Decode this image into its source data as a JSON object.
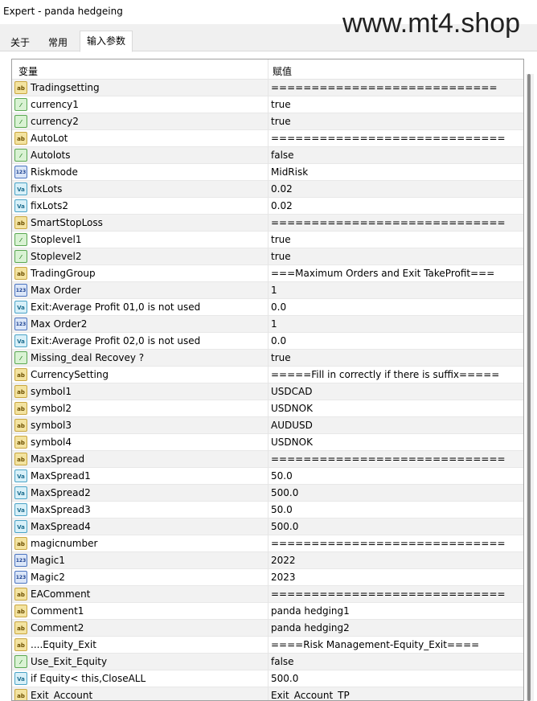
{
  "window": {
    "title": "Expert - panda hedgeing"
  },
  "watermark": "www.mt4.shop",
  "tabs": [
    {
      "label": "关于"
    },
    {
      "label": "常用"
    },
    {
      "label": "输入参数"
    }
  ],
  "grid": {
    "col_variable": "变量",
    "col_value": "赋值",
    "rows": [
      {
        "icon": "ab",
        "name": "Tradingsetting",
        "value": "============================"
      },
      {
        "icon": "bool",
        "name": "currency1",
        "value": "true"
      },
      {
        "icon": "bool",
        "name": "currency2",
        "value": "true"
      },
      {
        "icon": "ab",
        "name": "AutoLot",
        "value": "============================="
      },
      {
        "icon": "bool",
        "name": "Autolots",
        "value": "false"
      },
      {
        "icon": "int",
        "name": "Riskmode",
        "value": "MidRisk"
      },
      {
        "icon": "dbl",
        "name": "fixLots",
        "value": "0.02"
      },
      {
        "icon": "dbl",
        "name": "fixLots2",
        "value": "0.02"
      },
      {
        "icon": "ab",
        "name": "SmartStopLoss",
        "value": "============================="
      },
      {
        "icon": "bool",
        "name": "Stoplevel1",
        "value": "true"
      },
      {
        "icon": "bool",
        "name": "Stoplevel2",
        "value": "true"
      },
      {
        "icon": "ab",
        "name": "TradingGroup",
        "value": "===Maximum Orders and Exit TakeProfit==="
      },
      {
        "icon": "int",
        "name": "Max Order",
        "value": "1"
      },
      {
        "icon": "dbl",
        "name": "Exit:Average Profit 01,0 is not used",
        "value": "0.0"
      },
      {
        "icon": "int",
        "name": "Max Order2",
        "value": "1"
      },
      {
        "icon": "dbl",
        "name": "Exit:Average Profit 02,0 is not used",
        "value": "0.0"
      },
      {
        "icon": "bool",
        "name": "Missing_deal Recovey ?",
        "value": "true"
      },
      {
        "icon": "ab",
        "name": "CurrencySetting",
        "value": "=====Fill in correctly if there is suffix====="
      },
      {
        "icon": "ab",
        "name": "symbol1",
        "value": "USDCAD"
      },
      {
        "icon": "ab",
        "name": "symbol2",
        "value": "USDNOK"
      },
      {
        "icon": "ab",
        "name": "symbol3",
        "value": "AUDUSD"
      },
      {
        "icon": "ab",
        "name": "symbol4",
        "value": "USDNOK"
      },
      {
        "icon": "ab",
        "name": "MaxSpread",
        "value": "============================="
      },
      {
        "icon": "dbl",
        "name": "MaxSpread1",
        "value": "50.0"
      },
      {
        "icon": "dbl",
        "name": "MaxSpread2",
        "value": "500.0"
      },
      {
        "icon": "dbl",
        "name": "MaxSpread3",
        "value": "50.0"
      },
      {
        "icon": "dbl",
        "name": "MaxSpread4",
        "value": "500.0"
      },
      {
        "icon": "ab",
        "name": "magicnumber",
        "value": "============================="
      },
      {
        "icon": "int",
        "name": "Magic1",
        "value": "2022"
      },
      {
        "icon": "int",
        "name": "Magic2",
        "value": "2023"
      },
      {
        "icon": "ab",
        "name": "EAComment",
        "value": "============================="
      },
      {
        "icon": "ab",
        "name": "Comment1",
        "value": "panda hedging1"
      },
      {
        "icon": "ab",
        "name": "Comment2",
        "value": "panda hedging2"
      },
      {
        "icon": "ab",
        "name": "....Equity_Exit",
        "value": "====Risk Management-Equity_Exit===="
      },
      {
        "icon": "bool",
        "name": "Use_Exit_Equity",
        "value": "false"
      },
      {
        "icon": "dbl",
        "name": "if Equity< this,CloseALL",
        "value": "500.0"
      },
      {
        "icon": "ab",
        "name": "Exit_Account",
        "value": "Exit_Account_TP"
      }
    ]
  },
  "icon_names": {
    "ab": "string-type-icon",
    "bool": "bool-type-icon",
    "int": "integer-type-icon",
    "dbl": "double-type-icon"
  },
  "icon_glyphs": {
    "ab": "ab",
    "bool": "⁄",
    "int": "123",
    "dbl": "Va"
  }
}
